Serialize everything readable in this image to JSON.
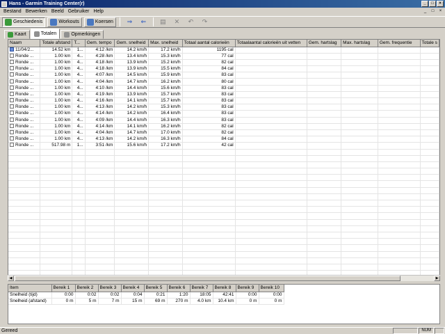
{
  "window": {
    "title": "Hans - Garmin Training Center(r)",
    "min": "_",
    "max": "□",
    "close": "×"
  },
  "menu": [
    "Bestand",
    "Bewerken",
    "Beeld",
    "Gebruiker",
    "Help"
  ],
  "mdi_controls": {
    "min": "_",
    "max": "□",
    "close": "×"
  },
  "toolbar": {
    "history": "Geschiedenis",
    "workouts": "Workouts",
    "courses": "Koersen"
  },
  "tabs": [
    "Kaart",
    "Totalen",
    "Opmerkingen"
  ],
  "grid": {
    "columns": [
      "Naam",
      "Totale afstand",
      "T...",
      "Gem. tempo",
      "Gem. snelheid",
      "Max. snelheid",
      "Totaal aantal calorieën",
      "Totaalaantal calorieën uit vetten",
      "Gem. hartslag",
      "Max. hartslag",
      "Gem. frequentie",
      "Totale s"
    ],
    "rows": [
      [
        "11/04/2...",
        "14.52 km",
        "1...",
        "4:12 /km",
        "14.2 km/h",
        "17.2 km/h",
        "1195 cal",
        "",
        "",
        "",
        "",
        ""
      ],
      [
        "Ronde ...",
        "1.00 km",
        "4...",
        "4:28 /km",
        "13.4 km/h",
        "15.3 km/h",
        "77 cal",
        "",
        "",
        "",
        "",
        ""
      ],
      [
        "Ronde ...",
        "1.00 km",
        "4...",
        "4:18 /km",
        "13.9 km/h",
        "15.2 km/h",
        "82 cal",
        "",
        "",
        "",
        "",
        ""
      ],
      [
        "Ronde ...",
        "1.00 km",
        "4...",
        "4:18 /km",
        "13.9 km/h",
        "15.5 km/h",
        "84 cal",
        "",
        "",
        "",
        "",
        ""
      ],
      [
        "Ronde ...",
        "1.00 km",
        "4...",
        "4:07 /km",
        "14.5 km/h",
        "15.9 km/h",
        "83 cal",
        "",
        "",
        "",
        "",
        ""
      ],
      [
        "Ronde ...",
        "1.00 km",
        "4...",
        "4:04 /km",
        "14.7 km/h",
        "16.2 km/h",
        "80 cal",
        "",
        "",
        "",
        "",
        ""
      ],
      [
        "Ronde ...",
        "1.00 km",
        "4...",
        "4:10 /km",
        "14.4 km/h",
        "15.6 km/h",
        "83 cal",
        "",
        "",
        "",
        "",
        ""
      ],
      [
        "Ronde ...",
        "1.00 km",
        "4...",
        "4:19 /km",
        "13.9 km/h",
        "15.7 km/h",
        "83 cal",
        "",
        "",
        "",
        "",
        ""
      ],
      [
        "Ronde ...",
        "1.00 km",
        "4...",
        "4:16 /km",
        "14.1 km/h",
        "15.7 km/h",
        "83 cal",
        "",
        "",
        "",
        "",
        ""
      ],
      [
        "Ronde ...",
        "1.00 km",
        "4...",
        "4:13 /km",
        "14.2 km/h",
        "15.3 km/h",
        "83 cal",
        "",
        "",
        "",
        "",
        ""
      ],
      [
        "Ronde ...",
        "1.00 km",
        "4...",
        "4:14 /km",
        "14.2 km/h",
        "16.4 km/h",
        "83 cal",
        "",
        "",
        "",
        "",
        ""
      ],
      [
        "Ronde ...",
        "1.00 km",
        "4...",
        "4:09 /km",
        "14.4 km/h",
        "16.3 km/h",
        "83 cal",
        "",
        "",
        "",
        "",
        ""
      ],
      [
        "Ronde ...",
        "1.00 km",
        "4...",
        "4:14 /km",
        "14.1 km/h",
        "16.2 km/h",
        "82 cal",
        "",
        "",
        "",
        "",
        ""
      ],
      [
        "Ronde ...",
        "1.00 km",
        "4...",
        "4:04 /km",
        "14.7 km/h",
        "17.0 km/h",
        "82 cal",
        "",
        "",
        "",
        "",
        ""
      ],
      [
        "Ronde ...",
        "1.00 km",
        "4...",
        "4:13 /km",
        "14.2 km/h",
        "16.3 km/h",
        "84 cal",
        "",
        "",
        "",
        "",
        ""
      ],
      [
        "Ronde ...",
        "517.98 m",
        "1...",
        "3:51 /km",
        "15.6 km/h",
        "17.2 km/h",
        "42 cal",
        "",
        "",
        "",
        "",
        ""
      ]
    ]
  },
  "zones": {
    "columns": [
      "Item",
      "Bereik 1",
      "Bereik 2",
      "Bereik 3",
      "Bereik 4",
      "Bereik 5",
      "Bereik 6",
      "Bereik 7",
      "Bereik 8",
      "Bereik 9",
      "Bereik 10"
    ],
    "rows": [
      [
        "Snelheid (tijd)",
        "0:00",
        "0:02",
        "0:02",
        "0:04",
        "0:21",
        "1:20",
        "18:05",
        "42:41",
        "0:00",
        "0:00"
      ],
      [
        "Snelheid (afstand)",
        "0 m",
        "5 m",
        "7 m",
        "15 m",
        "69 m",
        "270 m",
        "4.0 km",
        "10.4 km",
        "0 m",
        "0 m"
      ]
    ]
  },
  "status": {
    "text": "Gereed",
    "num": "NUM"
  }
}
